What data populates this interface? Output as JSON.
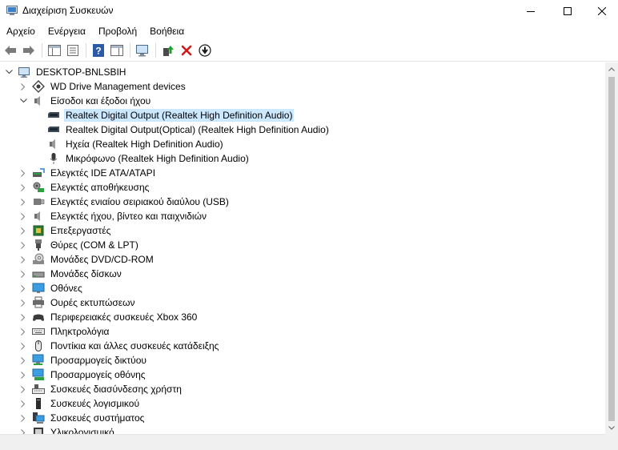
{
  "window": {
    "title": "Διαχείριση Συσκευών",
    "controls": [
      "minimize",
      "maximize",
      "close"
    ]
  },
  "menu": [
    "Αρχείο",
    "Ενέργεια",
    "Προβολή",
    "Βοήθεια"
  ],
  "toolbar": [
    "back-icon",
    "forward-icon",
    "show-hide-console-tree-icon",
    "properties-icon",
    "help-icon",
    "action-pane-icon",
    "scan-hardware-icon",
    "update-driver-icon",
    "uninstall-icon",
    "disable-device-icon"
  ],
  "tree": {
    "root": "DESKTOP-BNLSBIH",
    "categories": [
      {
        "label": "WD Drive Management devices",
        "icon": "wd-gear-icon",
        "expanded": false
      },
      {
        "label": "Είσοδοι και έξοδοι ήχου",
        "icon": "speaker-icon",
        "expanded": true,
        "children": [
          {
            "label": "Realtek Digital Output (Realtek High Definition Audio)",
            "icon": "audio-device-icon",
            "selected": true
          },
          {
            "label": "Realtek Digital Output(Optical) (Realtek High Definition Audio)",
            "icon": "audio-device-icon"
          },
          {
            "label": "Ηχεία (Realtek High Definition Audio)",
            "icon": "speaker-icon"
          },
          {
            "label": "Μικρόφωνο (Realtek High Definition Audio)",
            "icon": "microphone-icon"
          }
        ]
      },
      {
        "label": "Ελεγκτές IDE ATA/ATAPI",
        "icon": "ide-controller-icon",
        "expanded": false
      },
      {
        "label": "Ελεγκτές αποθήκευσης",
        "icon": "storage-controller-icon",
        "expanded": false
      },
      {
        "label": "Ελεγκτές ενιαίου σειριακού διαύλου (USB)",
        "icon": "usb-icon",
        "expanded": false
      },
      {
        "label": "Ελεγκτές ήχου, βίντεο και παιχνιδιών",
        "icon": "speaker-icon",
        "expanded": false
      },
      {
        "label": "Επεξεργαστές",
        "icon": "processor-icon",
        "expanded": false
      },
      {
        "label": "Θύρες (COM & LPT)",
        "icon": "port-icon",
        "expanded": false
      },
      {
        "label": "Μονάδες DVD/CD-ROM",
        "icon": "dvd-drive-icon",
        "expanded": false
      },
      {
        "label": "Μονάδες δίσκων",
        "icon": "disk-drive-icon",
        "expanded": false
      },
      {
        "label": "Οθόνες",
        "icon": "monitor-icon",
        "expanded": false
      },
      {
        "label": "Ουρές εκτυπώσεων",
        "icon": "printer-icon",
        "expanded": false
      },
      {
        "label": "Περιφερειακές συσκευές Xbox 360",
        "icon": "gamepad-icon",
        "expanded": false
      },
      {
        "label": "Πληκτρολόγια",
        "icon": "keyboard-icon",
        "expanded": false
      },
      {
        "label": "Ποντίκια και άλλες συσκευές κατάδειξης",
        "icon": "mouse-icon",
        "expanded": false
      },
      {
        "label": "Προσαρμογείς δικτύου",
        "icon": "network-adapter-icon",
        "expanded": false
      },
      {
        "label": "Προσαρμογείς οθόνης",
        "icon": "display-adapter-icon",
        "expanded": false
      },
      {
        "label": "Συσκευές διασύνδεσης χρήστη",
        "icon": "hid-icon",
        "expanded": false
      },
      {
        "label": "Συσκευές λογισμικού",
        "icon": "software-device-icon",
        "expanded": false
      },
      {
        "label": "Συσκευές συστήματος",
        "icon": "system-device-icon",
        "expanded": false
      },
      {
        "label": "Υλικολογισμικό",
        "icon": "firmware-icon",
        "expanded": false
      }
    ]
  },
  "colors": {
    "selection": "#cce8ff",
    "accent": "#0078d7"
  }
}
